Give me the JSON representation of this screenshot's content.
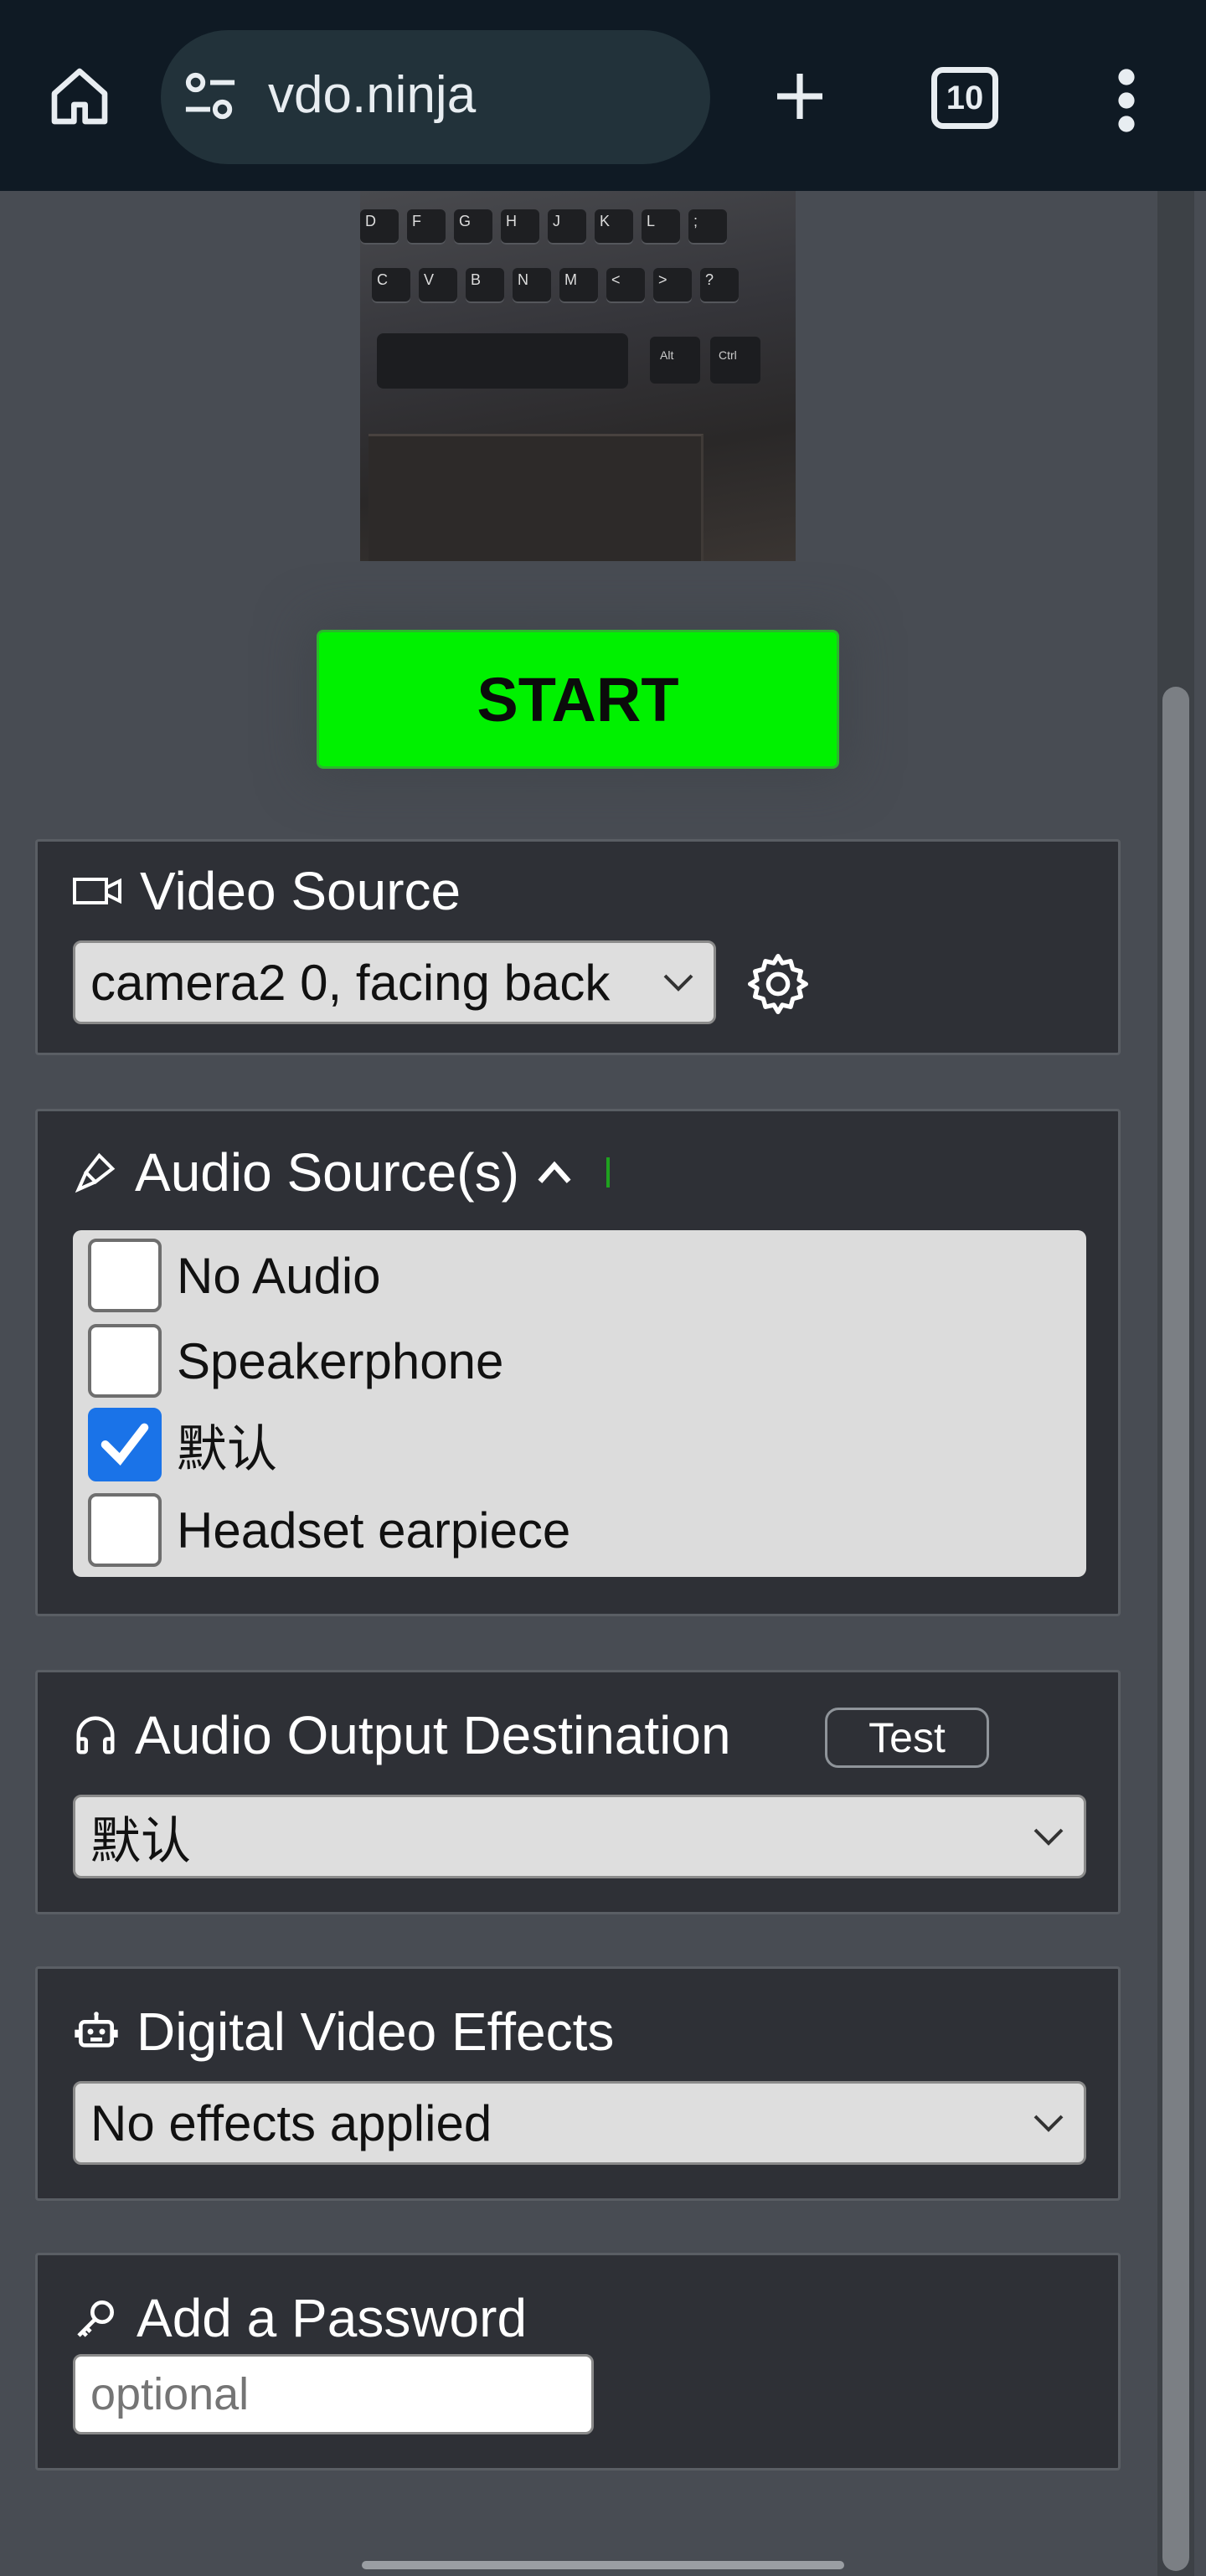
{
  "browser": {
    "url": "vdo.ninja",
    "tab_count": "10",
    "icons": [
      "home-icon",
      "site-settings-icon",
      "new-tab-icon",
      "tab-switcher-icon",
      "more-menu-icon"
    ]
  },
  "preview": {
    "keys_row1": [
      "D",
      "F",
      "G",
      "H",
      "J",
      "K",
      "L",
      ";"
    ],
    "keys_row2": [
      "C",
      "V",
      "B",
      "N",
      "M",
      "<",
      ">",
      "?"
    ],
    "alt_key": "Alt",
    "ctrl_key": "Ctrl"
  },
  "start_button": {
    "label": "START",
    "color": "#00f100"
  },
  "video_source": {
    "title": "Video Source",
    "selected": "camera2 0, facing back"
  },
  "audio_source": {
    "title": "Audio Source(s)",
    "options": [
      {
        "label": "No Audio",
        "checked": false
      },
      {
        "label": "Speakerphone",
        "checked": false
      },
      {
        "label": "默认",
        "checked": true
      },
      {
        "label": "Headset earpiece",
        "checked": false
      }
    ]
  },
  "audio_output": {
    "title": "Audio Output Destination",
    "test_label": "Test",
    "selected": "默认"
  },
  "video_effects": {
    "title": "Digital Video Effects",
    "selected": "No effects applied"
  },
  "password": {
    "title": "Add a Password",
    "placeholder": "optional",
    "value": ""
  }
}
